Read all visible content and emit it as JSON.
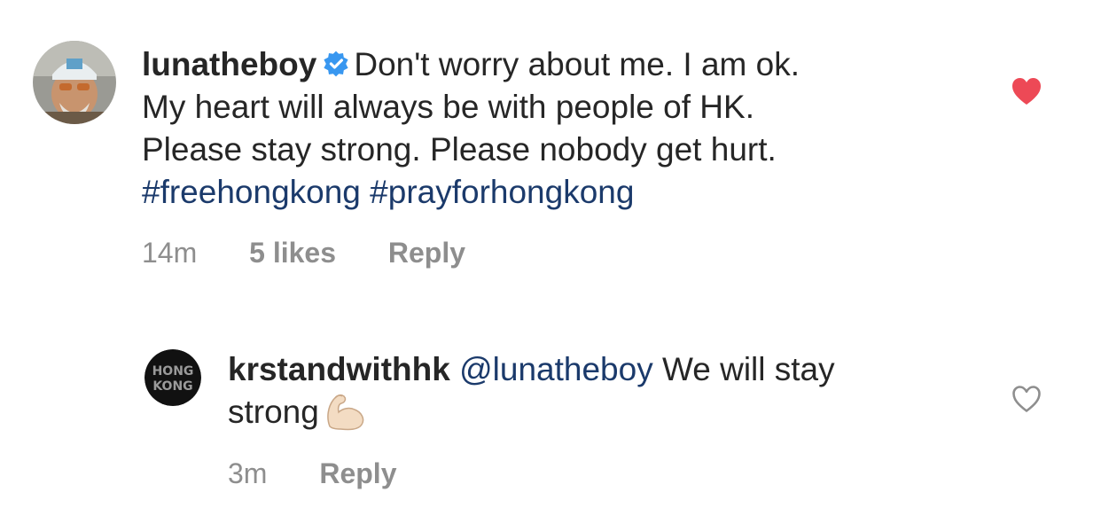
{
  "comments": [
    {
      "username": "lunatheboy",
      "verified": true,
      "text_line1": "Don't worry about me. I am ok.",
      "text_line2": "My heart will always be with people of HK.",
      "text_line3": "Please stay strong. Please nobody get hurt.",
      "hashtags": [
        "#freehongkong",
        "#prayforhongkong"
      ],
      "time": "14m",
      "likes": "5 likes",
      "reply_label": "Reply",
      "liked": true,
      "heart_color": "#ed4956"
    },
    {
      "username": "krstandwithhk",
      "mention": "@lunatheboy",
      "text_line1": "We will stay",
      "text_line2": "strong",
      "emoji": "flexed-biceps",
      "avatar_text": [
        "HONG",
        "KONG"
      ],
      "time": "3m",
      "reply_label": "Reply",
      "liked": false
    }
  ]
}
